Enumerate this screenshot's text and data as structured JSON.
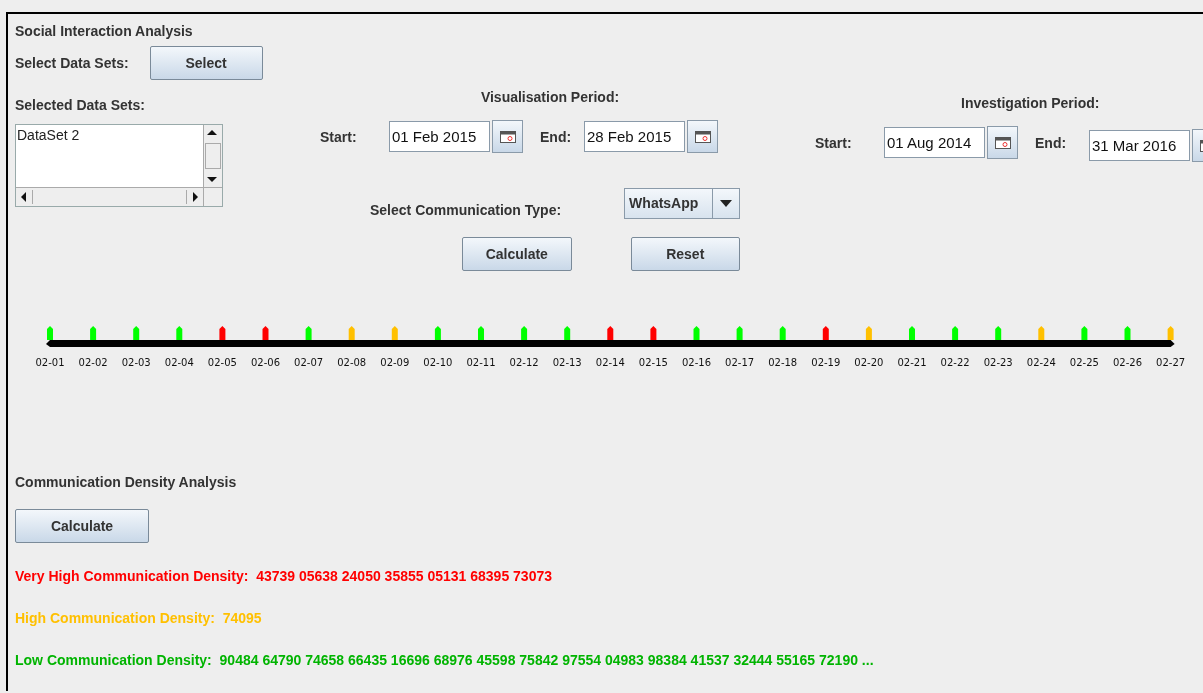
{
  "title": "Social Interaction Analysis",
  "select_data_sets": {
    "label": "Select Data Sets:",
    "button": "Select"
  },
  "selected_data_sets": {
    "label": "Selected Data Sets:",
    "items": [
      "DataSet 2"
    ]
  },
  "visualisation_period": {
    "title": "Visualisation Period:",
    "start_label": "Start:",
    "start": "01 Feb 2015",
    "end_label": "End:",
    "end": "28 Feb 2015"
  },
  "investigation_period": {
    "title": "Investigation Period:",
    "start_label": "Start:",
    "start": "01 Aug 2014",
    "end_label": "End:",
    "end": "31 Mar 2016"
  },
  "communication_type": {
    "label": "Select Communication Type:",
    "value": "WhatsApp"
  },
  "buttons": [
    "Calculate",
    "Reset"
  ],
  "timeline": [
    {
      "label": "02-01",
      "color": "#00ff00"
    },
    {
      "label": "02-02",
      "color": "#00ff00"
    },
    {
      "label": "02-03",
      "color": "#00ff00"
    },
    {
      "label": "02-04",
      "color": "#00ff00"
    },
    {
      "label": "02-05",
      "color": "#ff0000"
    },
    {
      "label": "02-06",
      "color": "#ff0000"
    },
    {
      "label": "02-07",
      "color": "#00ff00"
    },
    {
      "label": "02-08",
      "color": "#ffc000"
    },
    {
      "label": "02-09",
      "color": "#ffc000"
    },
    {
      "label": "02-10",
      "color": "#00ff00"
    },
    {
      "label": "02-11",
      "color": "#00ff00"
    },
    {
      "label": "02-12",
      "color": "#00ff00"
    },
    {
      "label": "02-13",
      "color": "#00ff00"
    },
    {
      "label": "02-14",
      "color": "#ff0000"
    },
    {
      "label": "02-15",
      "color": "#ff0000"
    },
    {
      "label": "02-16",
      "color": "#00ff00"
    },
    {
      "label": "02-17",
      "color": "#00ff00"
    },
    {
      "label": "02-18",
      "color": "#00ff00"
    },
    {
      "label": "02-19",
      "color": "#ff0000"
    },
    {
      "label": "02-20",
      "color": "#ffc000"
    },
    {
      "label": "02-21",
      "color": "#00ff00"
    },
    {
      "label": "02-22",
      "color": "#00ff00"
    },
    {
      "label": "02-23",
      "color": "#00ff00"
    },
    {
      "label": "02-24",
      "color": "#ffc000"
    },
    {
      "label": "02-25",
      "color": "#00ff00"
    },
    {
      "label": "02-26",
      "color": "#00ff00"
    },
    {
      "label": "02-27",
      "color": "#ffc000"
    }
  ],
  "density_analysis": {
    "title": "Communication Density Analysis",
    "button": "Calculate",
    "results": [
      {
        "label": "Very High Communication Density:",
        "values": "43739 05638 24050 35855 05131 68395 73073",
        "color": "#ff0000"
      },
      {
        "label": "High Communication Density:",
        "values": "74095",
        "color": "#ffc000"
      },
      {
        "label": "Low Communication Density:",
        "values": "90484 64790 74658 66435 16696 68976 45598 75842 97554 04983 98384 41537 32444 55165 72190 ...",
        "color": "#00b400"
      }
    ]
  }
}
